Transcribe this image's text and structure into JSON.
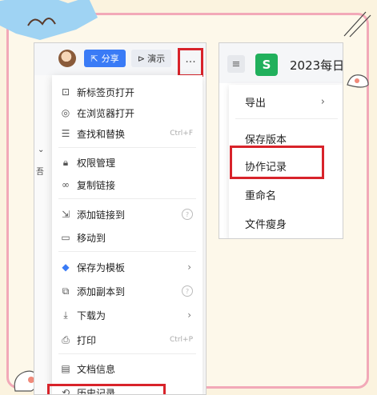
{
  "left_panel": {
    "toolbar": {
      "share_label": "分享",
      "present_label": "演示",
      "more_label": "···"
    },
    "edge_chevron": "⌄",
    "edge_char": "吾",
    "menu": [
      {
        "label": "新标签页打开",
        "icon": "new-tab-icon"
      },
      {
        "label": "在浏览器打开",
        "icon": "browser-icon"
      },
      {
        "label": "查找和替换",
        "icon": "find-replace-icon",
        "shortcut": "Ctrl+F"
      },
      {
        "label": "权限管理",
        "icon": "lock-icon"
      },
      {
        "label": "复制链接",
        "icon": "link-icon"
      },
      {
        "label": "添加链接到",
        "icon": "add-link-icon"
      },
      {
        "label": "移动到",
        "icon": "move-folder-icon"
      },
      {
        "label": "保存为模板",
        "icon": "template-icon"
      },
      {
        "label": "添加副本到",
        "icon": "copy-icon"
      },
      {
        "label": "下载为",
        "icon": "download-icon"
      },
      {
        "label": "打印",
        "icon": "printer-icon",
        "shortcut": "Ctrl+P"
      },
      {
        "label": "文档信息",
        "icon": "doc-info-icon"
      },
      {
        "label": "历史记录",
        "icon": "history-icon"
      }
    ],
    "help_glyph": "?",
    "arrow_glyph": "›"
  },
  "right_panel": {
    "logo_letter": "S",
    "title": "2023每日",
    "menu": [
      {
        "label": "导出"
      },
      {
        "label": "保存版本"
      },
      {
        "label": "协作记录"
      },
      {
        "label": "重命名"
      },
      {
        "label": "文件瘦身"
      }
    ],
    "arrow_glyph": "›"
  },
  "colors": {
    "highlight": "#d8232a",
    "accent": "#3a7bf6",
    "logo": "#21b05c",
    "frame": "#f2a9b8"
  }
}
